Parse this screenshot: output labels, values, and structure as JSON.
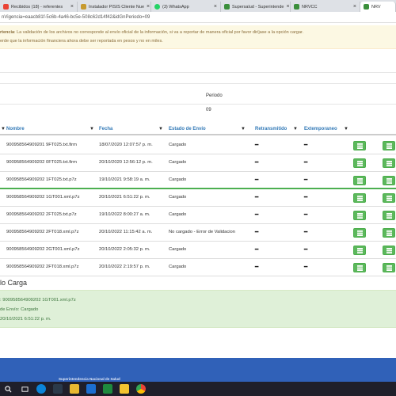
{
  "browser": {
    "tabs": [
      {
        "label": "Recibidos (18) - referentes",
        "close": "×",
        "color": "#ea4335"
      },
      {
        "label": "Instalador PISIS Cliente Nue",
        "close": "×",
        "color": "#c79a2e"
      },
      {
        "label": "(3) WhatsApp",
        "close": "×",
        "color": "#25d366"
      },
      {
        "label": "Supersalud - Superintende",
        "close": "×",
        "color": "#3b8f3b"
      },
      {
        "label": "NRVCC",
        "close": "×",
        "color": "#3b8f3b"
      },
      {
        "label": "NRV",
        "close": "",
        "color": "#3b8f3b"
      }
    ],
    "url": "nVigencia=eaacb81f-5c6b-4a46-bc5e-508c62d14f42&idGnPeriodo=09"
  },
  "alert": {
    "line1_strong": "rtencia",
    "line1_text": ": La validación de los archivos no corresponde al envío oficial de la información, si va a reportar de manera oficial por favor diríjase a la opción cargar.",
    "line2_text": "erde que la información financiera ahora debe ser reportada en pesos y no en miles."
  },
  "periodo": {
    "label": "Periodo",
    "value": "09"
  },
  "table": {
    "headers": {
      "nombre": "Nombre",
      "fecha": "Fecha",
      "estado": "Estado de Envío",
      "retransmitido": "Retransmitido",
      "extemporaneo": "Extemporaneo"
    },
    "rows": [
      {
        "nombre": "900958564909201 9FT025.txt.firm",
        "fecha": "18/07/2020 12:07:57 p. m.",
        "estado": "Cargado",
        "retransmitido": "━",
        "extemporaneo": "━"
      },
      {
        "nombre": "900958564909202 0FT025.txt.firm",
        "fecha": "20/10/2020 12:56:12 p. m.",
        "estado": "Cargado",
        "retransmitido": "━",
        "extemporaneo": "━"
      },
      {
        "nombre": "900958564909202 1FT025.txt.p7z",
        "fecha": "19/10/2021 9:58:19 a. m.",
        "estado": "Cargado",
        "retransmitido": "━",
        "extemporaneo": "━"
      },
      {
        "nombre": "900958564909202 1GT001.xml.p7z",
        "fecha": "20/10/2021 6:51:22 p. m.",
        "estado": "Cargado",
        "retransmitido": "━",
        "extemporaneo": "━"
      },
      {
        "nombre": "900958564909202 2FT025.txt.p7z",
        "fecha": "19/10/2022 8:00:27 a. m.",
        "estado": "Cargado",
        "retransmitido": "━",
        "extemporaneo": "━"
      },
      {
        "nombre": "900958564909202 2FT018.xml.p7z",
        "fecha": "20/10/2022 11:15:42 a. m.",
        "estado": "No cargado - Error de Validacion",
        "retransmitido": "━",
        "extemporaneo": "━"
      },
      {
        "nombre": "900958564909202 2GT001.xml.p7z",
        "fecha": "20/10/2022 2:05:32 p. m.",
        "estado": "Cargado",
        "retransmitido": "━",
        "extemporaneo": "━"
      },
      {
        "nombre": "900958564909202 2FT018.xml.p7z",
        "fecha": "20/10/2022 2:19:57 p. m.",
        "estado": "Cargado",
        "retransmitido": "━",
        "extemporaneo": "━"
      }
    ]
  },
  "detalle": {
    "title": "lo Carga",
    "archivo": ": 900958564909202 1GT001.xml.p7z",
    "estado": "de Envío: Cargado",
    "fecha": "20/10/2021 6:51:22 p. m."
  },
  "footer": {
    "text": "Superintendencia Nacional de Salud"
  },
  "colors": {
    "accent": "#337ab7",
    "success": "#5cb85c",
    "footer": "#3061b8",
    "warning_bg": "#fcf8e3"
  }
}
